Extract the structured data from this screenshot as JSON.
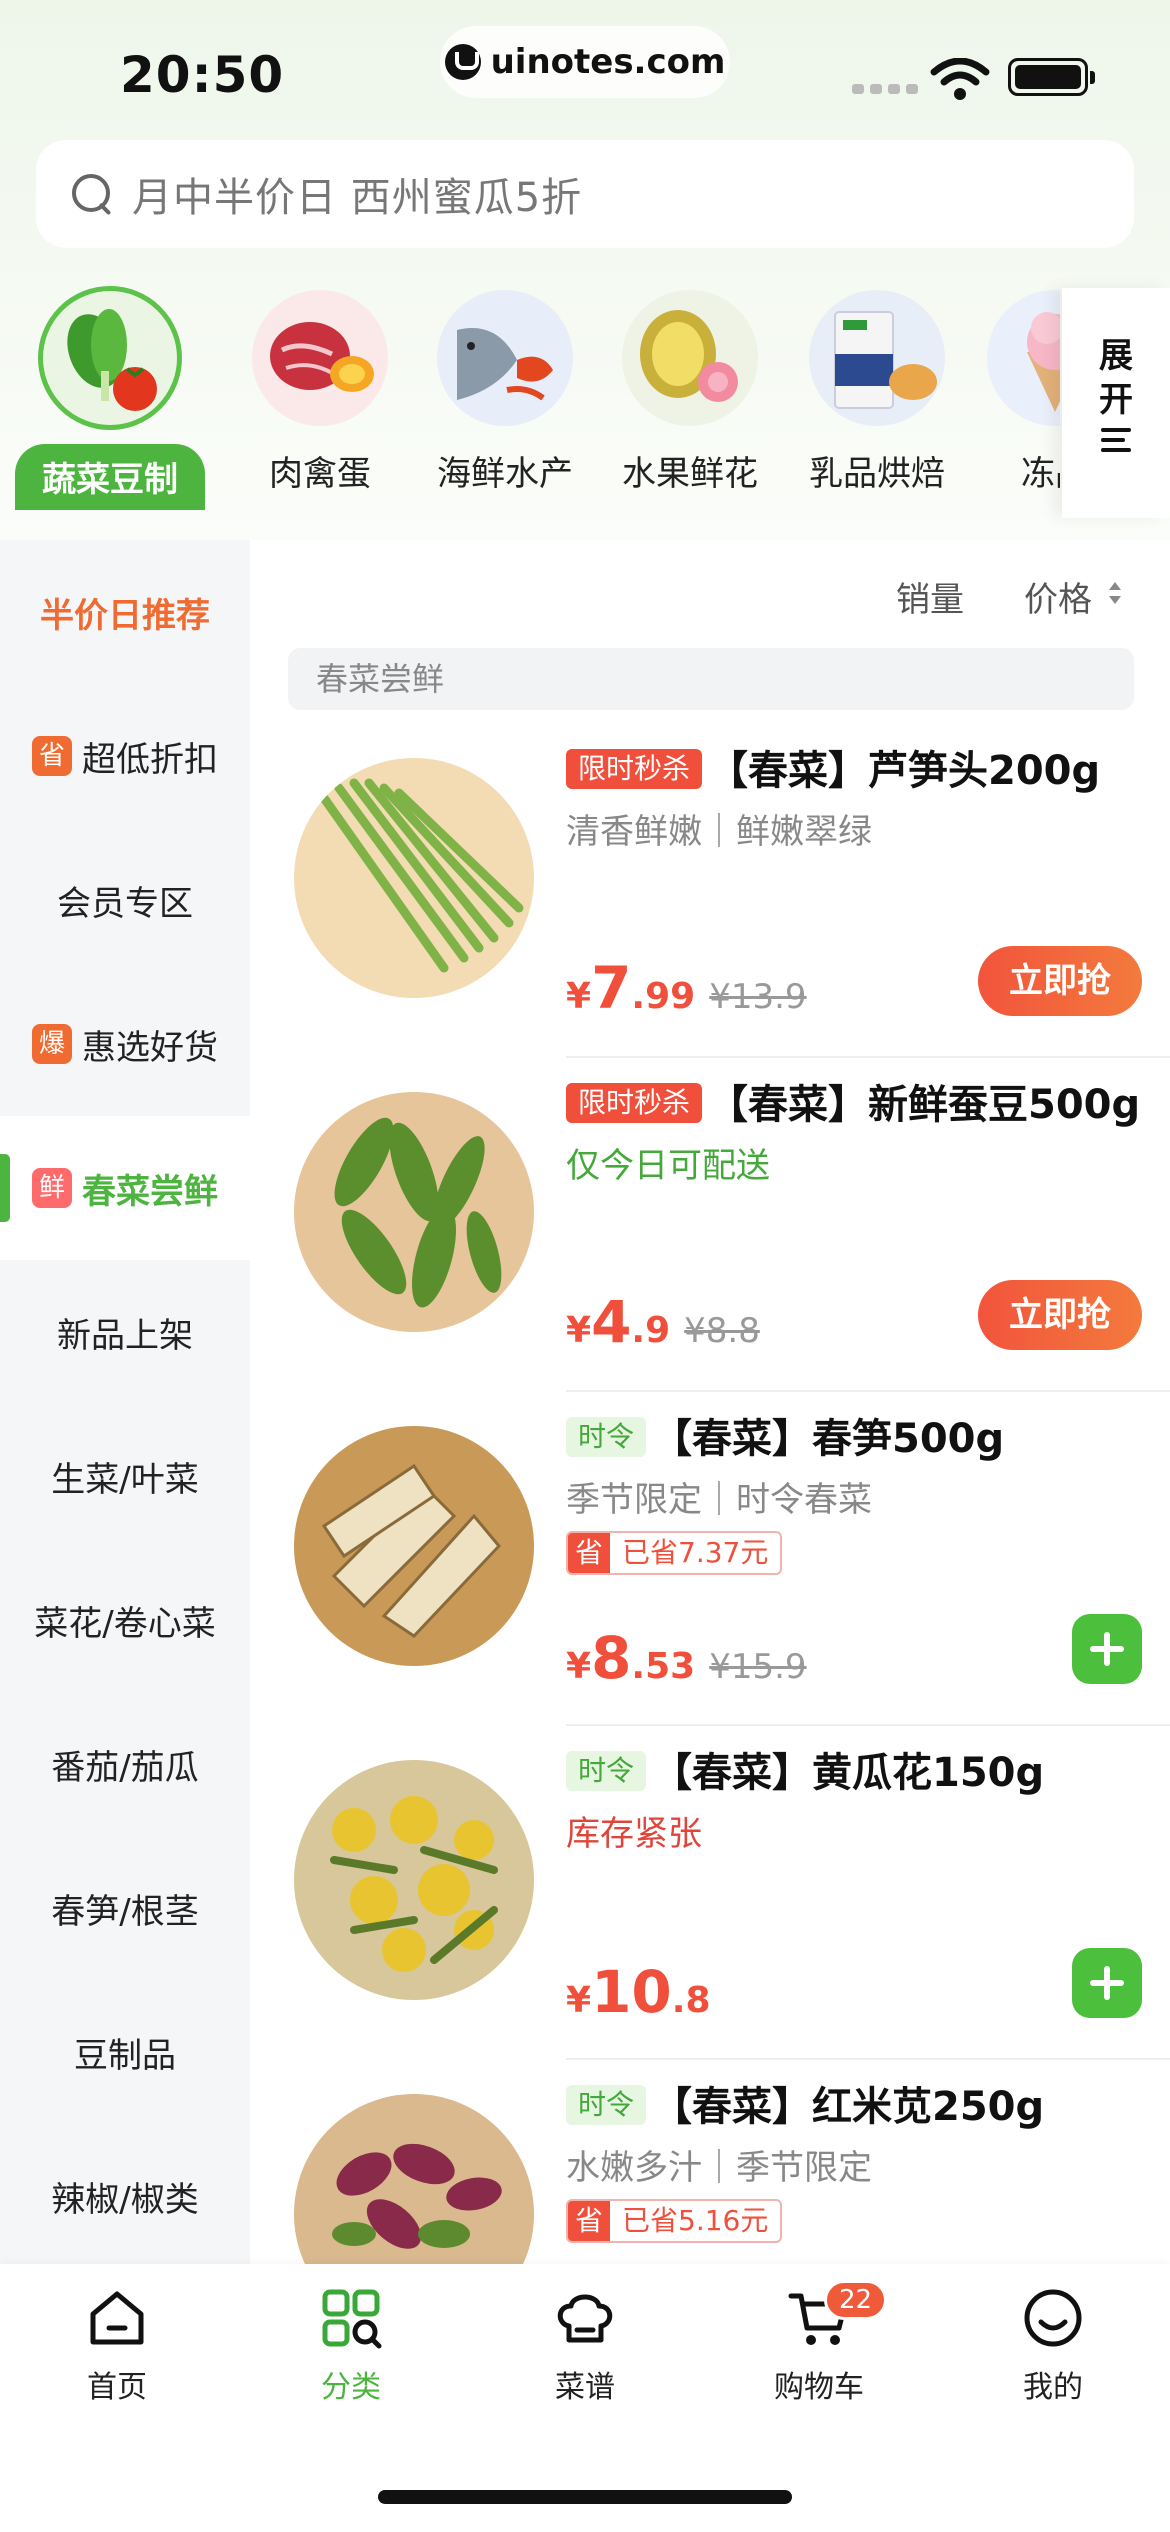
{
  "status_bar": {
    "time": "20:50",
    "url": "uinotes.com"
  },
  "search": {
    "placeholder": "月中半价日 西州蜜瓜5折"
  },
  "categories": [
    {
      "label": "蔬菜豆制品",
      "active": true
    },
    {
      "label": "肉禽蛋",
      "active": false
    },
    {
      "label": "海鲜水产",
      "active": false
    },
    {
      "label": "水果鲜花",
      "active": false
    },
    {
      "label": "乳品烘焙",
      "active": false
    },
    {
      "label": "冻品",
      "active": false
    }
  ],
  "expand_label": "展开",
  "sidebar": {
    "items": [
      {
        "label": "半价日推荐",
        "badge": "",
        "state": "promo"
      },
      {
        "label": "超低折扣",
        "badge": "省",
        "state": ""
      },
      {
        "label": "会员专区",
        "badge": "",
        "state": ""
      },
      {
        "label": "惠选好货",
        "badge": "爆",
        "state": ""
      },
      {
        "label": "春菜尝鲜",
        "badge": "鲜",
        "state": "active"
      },
      {
        "label": "新品上架",
        "badge": "",
        "state": ""
      },
      {
        "label": "生菜/叶菜",
        "badge": "",
        "state": ""
      },
      {
        "label": "菜花/卷心菜",
        "badge": "",
        "state": ""
      },
      {
        "label": "番茄/茄瓜",
        "badge": "",
        "state": ""
      },
      {
        "label": "春笋/根茎",
        "badge": "",
        "state": ""
      },
      {
        "label": "豆制品",
        "badge": "",
        "state": ""
      },
      {
        "label": "辣椒/椒类",
        "badge": "",
        "state": ""
      }
    ]
  },
  "sort": {
    "sales": "销量",
    "price": "价格"
  },
  "section_title": "春菜尝鲜",
  "products": [
    {
      "tag": "限时秒杀",
      "tag_type": "flash",
      "title": "【春菜】芦笋头200g",
      "subtitle": "清香鲜嫩｜鲜嫩翠绿",
      "subtitle_color": "grey",
      "save": "",
      "price_int": "7",
      "price_dec": ".99",
      "old_price": "¥13.9",
      "action": "buy",
      "action_label": "立即抢"
    },
    {
      "tag": "限时秒杀",
      "tag_type": "flash",
      "title": "【春菜】新鲜蚕豆500g",
      "subtitle": "仅今日可配送",
      "subtitle_color": "green",
      "save": "",
      "price_int": "4",
      "price_dec": ".9",
      "old_price": "¥8.8",
      "action": "buy",
      "action_label": "立即抢"
    },
    {
      "tag": "时令",
      "tag_type": "season",
      "title": "【春菜】春笋500g",
      "subtitle": "季节限定｜时令春菜",
      "subtitle_color": "grey",
      "save_icon": "省",
      "save": "已省7.37元",
      "price_int": "8",
      "price_dec": ".53",
      "old_price": "¥15.9",
      "action": "add",
      "action_label": ""
    },
    {
      "tag": "时令",
      "tag_type": "season",
      "title": "【春菜】黄瓜花150g",
      "subtitle": "库存紧张",
      "subtitle_color": "red",
      "save": "",
      "price_int": "10",
      "price_dec": ".8",
      "old_price": "",
      "action": "add",
      "action_label": ""
    },
    {
      "tag": "时令",
      "tag_type": "season",
      "title": "【春菜】红米苋250g",
      "subtitle": "水嫩多汁｜季节限定",
      "subtitle_color": "grey",
      "save_icon": "省",
      "save": "已省5.16元",
      "price_int": "",
      "price_dec": "",
      "old_price": "",
      "action": "",
      "action_label": ""
    }
  ],
  "currency": "¥",
  "bottom_nav": [
    {
      "label": "首页",
      "icon": "home-icon",
      "active": false
    },
    {
      "label": "分类",
      "icon": "category-icon",
      "active": true
    },
    {
      "label": "菜谱",
      "icon": "chef-hat-icon",
      "active": false
    },
    {
      "label": "购物车",
      "icon": "cart-icon",
      "active": false,
      "count": "22"
    },
    {
      "label": "我的",
      "icon": "profile-icon",
      "active": false
    }
  ],
  "colors": {
    "brand_green": "#4cb43f",
    "price_red": "#ef4f3b",
    "promo_orange": "#ef6b31"
  }
}
